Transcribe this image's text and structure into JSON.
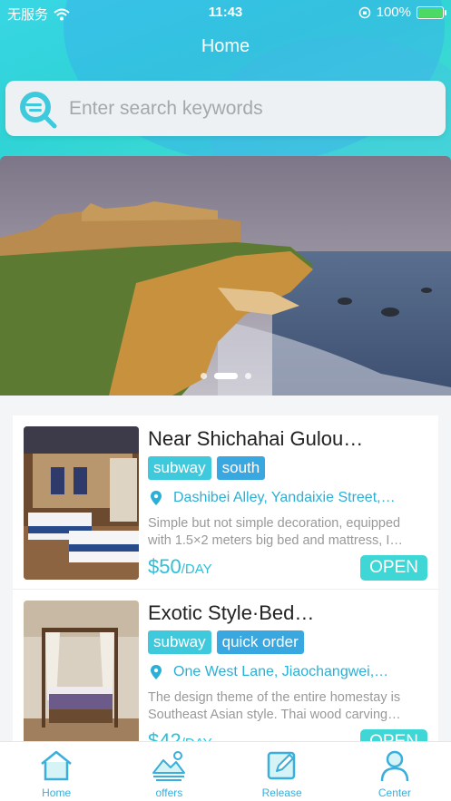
{
  "status_bar": {
    "carrier": "无服务",
    "time": "11:43",
    "battery": "100%"
  },
  "nav": {
    "title": "Home"
  },
  "search": {
    "placeholder": "Enter search keywords",
    "value": ""
  },
  "banner": {
    "slide_count": 3,
    "active_slide": 2
  },
  "listings": [
    {
      "title": "Near Shichahai Gulou…",
      "tags": [
        "subway",
        "south"
      ],
      "address": "Dashibei Alley, Yandaixie Street,…",
      "desc_line1": "Simple but not simple decoration, equipped",
      "desc_line2": "with 1.5×2 meters big bed and mattress, I…",
      "price": "$50",
      "unit": "/DAY",
      "status": "OPEN"
    },
    {
      "title": "Exotic Style·Bed…",
      "tags": [
        "subway",
        "quick order"
      ],
      "address": "One West Lane, Jiaochangwei,…",
      "desc_line1": "The design theme of the entire homestay is",
      "desc_line2": "Southeast Asian style. Thai wood carving…",
      "price": "$42",
      "unit": "/DAY",
      "status": "OPEN"
    }
  ],
  "tabbar": [
    {
      "label": "Home",
      "icon": "home-icon"
    },
    {
      "label": "offers",
      "icon": "landscape-icon"
    },
    {
      "label": "Release",
      "icon": "edit-icon"
    },
    {
      "label": "Center",
      "icon": "user-icon"
    }
  ],
  "colors": {
    "accent": "#3fd6d6",
    "link": "#2ab0d6",
    "tab": "#3aaedc"
  }
}
